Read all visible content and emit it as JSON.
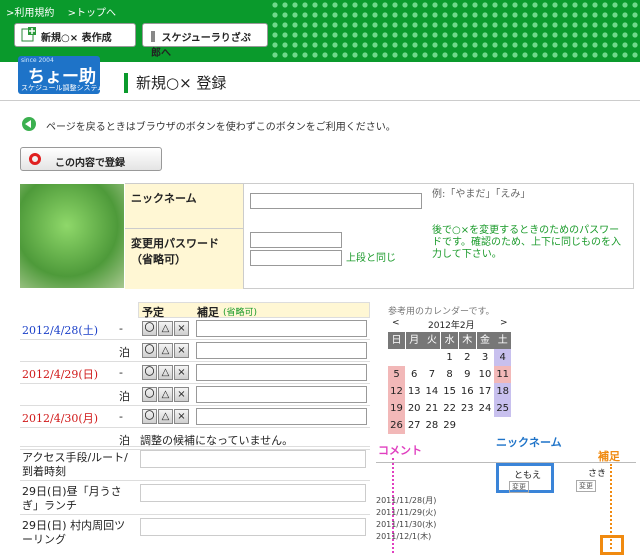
{
  "header": {
    "links": [
      ">利用規約",
      ">トップへ"
    ],
    "new_button": "新規○× 表作成",
    "scheduler_button": "スケジューラりざぷ郎へ"
  },
  "logo": {
    "since": "since 2004",
    "name": "ちょー助",
    "tagline": "スケジュール調整システム"
  },
  "page_title": "新規○× 登録",
  "notice": "ページを戻るときはブラウザのボタンを使わずこのボタンをご利用ください。",
  "register_button": "この内容で登録",
  "form": {
    "nickname_label": "ニックネーム",
    "nickname_hint": "例:「やまだ」「えみ」",
    "password_label": "変更用パスワード（省略可）",
    "password_same": "上段と同じ",
    "password_hint": "後で○×を変更するときのためのパスワードです。確認のため、上下に同じものを入力して下さい。"
  },
  "schedule": {
    "col_plan": "予定",
    "col_note": "補足",
    "col_note_opt": "(省略可)",
    "dash": "-",
    "tomari": "泊",
    "symbols": [
      "〇",
      "△",
      "×"
    ],
    "dates": [
      {
        "label": "2012/4/28(土)",
        "color": "#1a3fc8"
      },
      {
        "label": "2012/4/29(日)",
        "color": "#d01818"
      },
      {
        "label": "2012/4/30(月)",
        "color": "#d01818"
      }
    ],
    "no_candidate": "調整の候補になっていません。",
    "questions": [
      "アクセス手段/ルート/到着時刻",
      "29日(日)昼「月うさぎ」ランチ",
      "29日(日) 村内周回ツーリング"
    ]
  },
  "calendar": {
    "caption": "参考用のカレンダーです。",
    "prev": "<",
    "next": ">",
    "month": "2012年2月",
    "weekdays": [
      "日",
      "月",
      "火",
      "水",
      "木",
      "金",
      "土"
    ],
    "weeks": [
      [
        "",
        "",
        "",
        "1",
        "2",
        "3",
        "4"
      ],
      [
        "5",
        "6",
        "7",
        "8",
        "9",
        "10",
        "11"
      ],
      [
        "12",
        "13",
        "14",
        "15",
        "16",
        "17",
        "18"
      ],
      [
        "19",
        "20",
        "21",
        "22",
        "23",
        "24",
        "25"
      ],
      [
        "26",
        "27",
        "28",
        "29",
        "",
        "",
        ""
      ]
    ]
  },
  "help": {
    "comment_label": "コメント",
    "nickname_label": "ニックネーム",
    "hosoku_label": "補足",
    "col1": "ともえ",
    "col2": "さき",
    "change": "変更",
    "rows": [
      "2011/11/28(月)",
      "2011/11/29(火)",
      "2011/11/30(水)",
      "2011/12/1(木)"
    ]
  }
}
